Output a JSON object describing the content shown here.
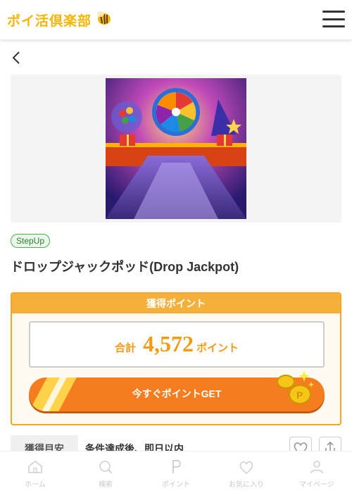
{
  "header": {
    "logo_text": "ポイ活倶楽部",
    "menu_icon": "hamburger-icon"
  },
  "nav": {
    "back_icon": "chevron-left-icon"
  },
  "offer": {
    "badge": "StepUp",
    "title": "ドロップジャックポッド(Drop Jackpot)"
  },
  "points": {
    "heading": "獲得ポイント",
    "total_label": "合計",
    "total_value": "4,572",
    "total_unit": "ポイント",
    "cta_label": "今すぐポイントGET"
  },
  "acquisition": {
    "label": "獲得目安",
    "value": "条件達成後、即日以内"
  },
  "bottom_nav": [
    {
      "label": "ホーム",
      "icon": "home-icon"
    },
    {
      "label": "検索",
      "icon": "search-icon"
    },
    {
      "label": "ポイント",
      "icon": "point-icon"
    },
    {
      "label": "お気に入り",
      "icon": "heart-icon"
    },
    {
      "label": "マイページ",
      "icon": "user-icon"
    }
  ],
  "colors": {
    "accent_orange": "#f57c1f",
    "points_gold": "#f39c12",
    "badge_green": "#4caf50",
    "logo_yellow": "#f7b500"
  }
}
